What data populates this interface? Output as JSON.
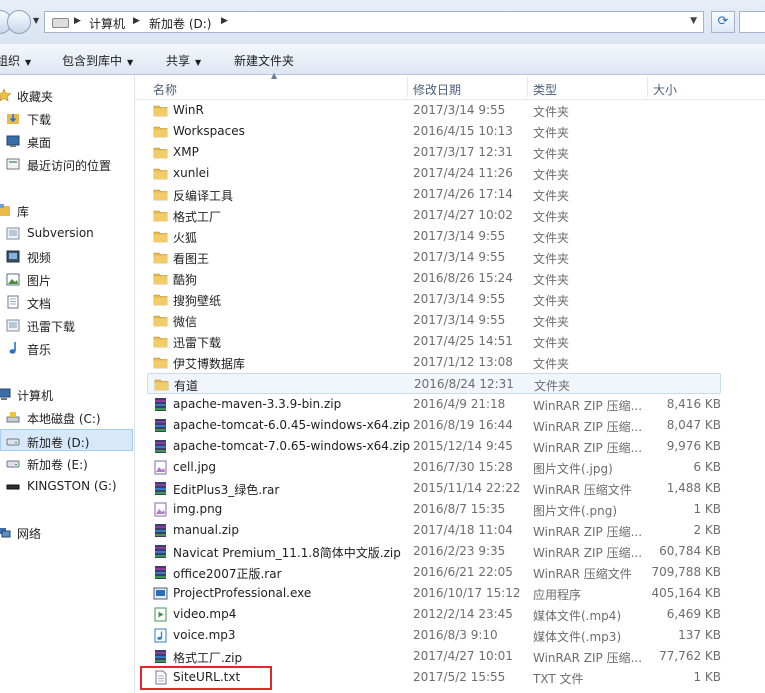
{
  "address": {
    "segments": [
      "计算机",
      "新加卷 (D:)"
    ]
  },
  "toolbar": {
    "organize": "组织",
    "include": "包含到库中",
    "share": "共享",
    "new_folder": "新建文件夹"
  },
  "nav": {
    "favorites": "收藏夹",
    "downloads": "下载",
    "desktop": "桌面",
    "recent": "最近访问的位置",
    "libraries": "库",
    "subversion": "Subversion",
    "videos": "视频",
    "pictures": "图片",
    "documents": "文档",
    "thunder": "迅雷下载",
    "music": "音乐",
    "computer": "计算机",
    "drive_c": "本地磁盘 (C:)",
    "drive_d": "新加卷 (D:)",
    "drive_e": "新加卷 (E:)",
    "drive_g": "KINGSTON (G:)",
    "network": "网络"
  },
  "columns": {
    "name": "名称",
    "date": "修改日期",
    "type": "类型",
    "size": "大小"
  },
  "files": [
    {
      "name": "WinR",
      "date": "2017/3/14 9:55",
      "type": "文件夹",
      "size": "",
      "icon": "folder-icon"
    },
    {
      "name": "Workspaces",
      "date": "2016/4/15 10:13",
      "type": "文件夹",
      "size": "",
      "icon": "folder-icon"
    },
    {
      "name": "XMP",
      "date": "2017/3/17 12:31",
      "type": "文件夹",
      "size": "",
      "icon": "folder-icon"
    },
    {
      "name": "xunlei",
      "date": "2017/4/24 11:26",
      "type": "文件夹",
      "size": "",
      "icon": "folder-icon"
    },
    {
      "name": "反编译工具",
      "date": "2017/4/26 17:14",
      "type": "文件夹",
      "size": "",
      "icon": "folder-icon"
    },
    {
      "name": "格式工厂",
      "date": "2017/4/27 10:02",
      "type": "文件夹",
      "size": "",
      "icon": "folder-icon"
    },
    {
      "name": "火狐",
      "date": "2017/3/14 9:55",
      "type": "文件夹",
      "size": "",
      "icon": "folder-icon"
    },
    {
      "name": "看图王",
      "date": "2017/3/14 9:55",
      "type": "文件夹",
      "size": "",
      "icon": "folder-icon"
    },
    {
      "name": "酷狗",
      "date": "2016/8/26 15:24",
      "type": "文件夹",
      "size": "",
      "icon": "folder-icon"
    },
    {
      "name": "搜狗壁纸",
      "date": "2017/3/14 9:55",
      "type": "文件夹",
      "size": "",
      "icon": "folder-icon"
    },
    {
      "name": "微信",
      "date": "2017/3/14 9:55",
      "type": "文件夹",
      "size": "",
      "icon": "folder-icon"
    },
    {
      "name": "迅雷下载",
      "date": "2017/4/25 14:51",
      "type": "文件夹",
      "size": "",
      "icon": "folder-icon"
    },
    {
      "name": "伊艾博数据库",
      "date": "2017/1/12 13:08",
      "type": "文件夹",
      "size": "",
      "icon": "folder-icon"
    },
    {
      "name": "有道",
      "date": "2016/8/24 12:31",
      "type": "文件夹",
      "size": "",
      "icon": "folder-icon"
    },
    {
      "name": "apache-maven-3.3.9-bin.zip",
      "date": "2016/4/9 21:18",
      "type": "WinRAR ZIP 压缩...",
      "size": "8,416 KB",
      "icon": "winrar-icon"
    },
    {
      "name": "apache-tomcat-6.0.45-windows-x64.zip",
      "date": "2016/8/19 16:44",
      "type": "WinRAR ZIP 压缩...",
      "size": "8,047 KB",
      "icon": "winrar-icon"
    },
    {
      "name": "apache-tomcat-7.0.65-windows-x64.zip",
      "date": "2015/12/14 9:45",
      "type": "WinRAR ZIP 压缩...",
      "size": "9,976 KB",
      "icon": "winrar-icon"
    },
    {
      "name": "cell.jpg",
      "date": "2016/7/30 15:28",
      "type": "图片文件(.jpg)",
      "size": "6 KB",
      "icon": "image-icon"
    },
    {
      "name": "EditPlus3_绿色.rar",
      "date": "2015/11/14 22:22",
      "type": "WinRAR 压缩文件",
      "size": "1,488 KB",
      "icon": "winrar-icon"
    },
    {
      "name": "img.png",
      "date": "2016/8/7 15:35",
      "type": "图片文件(.png)",
      "size": "1 KB",
      "icon": "image-icon"
    },
    {
      "name": "manual.zip",
      "date": "2017/4/18 11:04",
      "type": "WinRAR ZIP 压缩...",
      "size": "2 KB",
      "icon": "winrar-icon"
    },
    {
      "name": "Navicat Premium_11.1.8简体中文版.zip",
      "date": "2016/2/23 9:35",
      "type": "WinRAR ZIP 压缩...",
      "size": "60,784 KB",
      "icon": "winrar-icon"
    },
    {
      "name": "office2007正版.rar",
      "date": "2016/6/21 22:05",
      "type": "WinRAR 压缩文件",
      "size": "709,788 KB",
      "icon": "winrar-icon"
    },
    {
      "name": "ProjectProfessional.exe",
      "date": "2016/10/17 15:12",
      "type": "应用程序",
      "size": "405,164 KB",
      "icon": "exe-icon"
    },
    {
      "name": "video.mp4",
      "date": "2012/2/14 23:45",
      "type": "媒体文件(.mp4)",
      "size": "6,469 KB",
      "icon": "video-icon"
    },
    {
      "name": "voice.mp3",
      "date": "2016/8/3 9:10",
      "type": "媒体文件(.mp3)",
      "size": "137 KB",
      "icon": "audio-icon"
    },
    {
      "name": "格式工厂.zip",
      "date": "2017/4/27 10:01",
      "type": "WinRAR ZIP 压缩...",
      "size": "77,762 KB",
      "icon": "winrar-icon"
    },
    {
      "name": "SiteURL.txt",
      "date": "2017/5/2 15:55",
      "type": "TXT 文件",
      "size": "1 KB",
      "icon": "text-file-icon"
    }
  ],
  "colors": {
    "selected_bg": "#d7e8fb",
    "highlight_border": "#e0282d",
    "folder": "#e8b94c"
  }
}
